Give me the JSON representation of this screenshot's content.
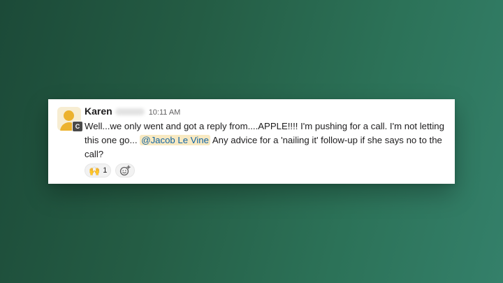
{
  "message": {
    "author": "Karen",
    "timestamp": "10:11 AM",
    "avatar_badge": "C",
    "text_before_mention": "Well...we only went and got a reply from....APPLE!!!! I'm pushing for a call. I'm not letting this one go... ",
    "mention": "@Jacob Le Vine",
    "text_after_mention": " Any advice for a 'nailing it' follow-up if she says no to the call?"
  },
  "reactions": [
    {
      "emoji": "🙌",
      "icon": "raised-hands-emoji",
      "count": "1"
    }
  ],
  "add_reaction_icon": "add-reaction-icon",
  "colors": {
    "background_gradient_start": "#1c4a38",
    "background_gradient_end": "#34806a",
    "mention_background": "#f8e9c1",
    "mention_text": "#1264a3",
    "avatar_accent": "#ecb22e"
  }
}
